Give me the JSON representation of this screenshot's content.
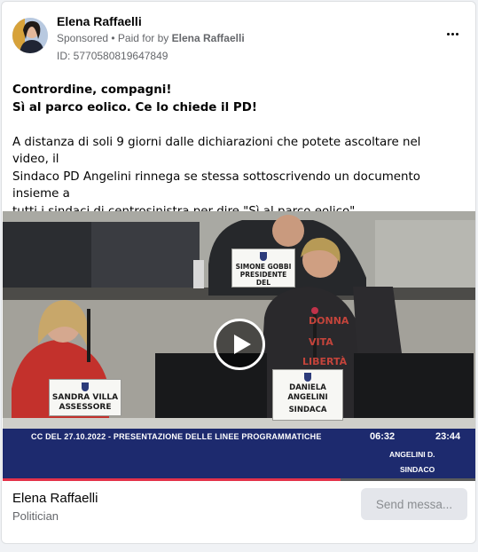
{
  "post": {
    "author": "Elena Raffaelli",
    "sponsored_label": "Sponsored",
    "separator": " • ",
    "paid_for_prefix": "Paid for by ",
    "paid_for_name": "Elena Raffaelli",
    "ad_id": "ID: 5770580819647849",
    "more_icon": "more-horizontal-icon",
    "headline_line1": "Contrordine, compagni!",
    "headline_line2": "Sì al parco eolico. Ce lo chiede il PD!",
    "body_line1": "A distanza di soli 9 giorni dalle dichiarazioni che potete ascoltare nel video, il",
    "body_line2": "Sindaco PD Angelini rinnega se stessa sottoscrivendo un documento insieme a",
    "body_line3": "tutti i sindaci di centrosinistra per dire \"Sì al parco eolico\".",
    "truncation": "..."
  },
  "video": {
    "play_icon": "play-icon",
    "progress_fraction": 0.71,
    "overlay_title": "CC DEL 27.10.2022 - PRESENTAZIONE DELLE LINEE PROGRAMMATICHE",
    "time_current": "06:32",
    "time_total": "23:44",
    "speaker_name": "ANGELINI D.",
    "speaker_role": "SINDACO",
    "nameplates": {
      "gobbi_line1": "SIMONE GOBBI",
      "gobbi_line2": "PRESIDENTE",
      "gobbi_line3": "DEL",
      "villa_line1": "SANDRA VILLA",
      "villa_line2": "ASSESSORE",
      "angelini_line1": "DANIELA",
      "angelini_line2": "ANGELINI",
      "angelini_line3": "SINDACA"
    },
    "shirt_text": [
      "DONNA",
      "VITA",
      "LIBERTÀ"
    ]
  },
  "footer": {
    "page_name": "Elena Raffaelli",
    "page_category": "Politician",
    "send_button": "Send messa..."
  },
  "colors": {
    "lower_third_bg": "#1d2a6e",
    "progress": "#e4324a",
    "secondary_text": "#65676b",
    "button_bg": "#e4e6eb"
  }
}
